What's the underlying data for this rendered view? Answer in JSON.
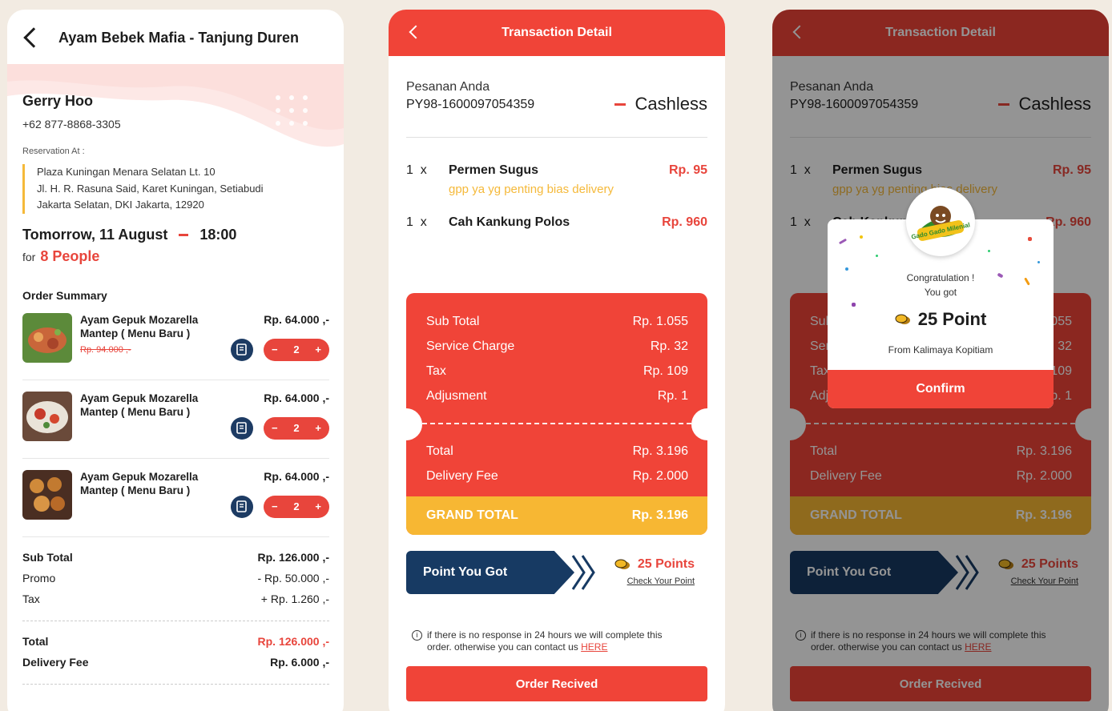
{
  "colors": {
    "accent_red": "#f04438",
    "navy": "#173a63",
    "gold": "#f7b733",
    "background": "#f2ebe2"
  },
  "reservation": {
    "header": {
      "title": "Ayam Bebek Mafia - Tanjung Duren",
      "back_icon": "chevron-left-icon"
    },
    "customer": {
      "name": "Gerry Hoo",
      "phone": "+62 877-8868-3305"
    },
    "reservation_label": "Reservation At :",
    "address": [
      "Plaza Kuningan Menara Selatan Lt. 10",
      "Jl. H. R. Rasuna Said, Karet Kuningan, Setiabudi",
      "Jakarta Selatan, DKI Jakarta, 12920"
    ],
    "date": "Tomorrow, 11 August",
    "time": "18:00",
    "for_label": "for",
    "people": "8 People",
    "order_summary_title": "Order Summary",
    "items": [
      {
        "name": "Ayam  Gepuk Mozarella Mantep ( Menu Baru )",
        "price": "Rp. 64.000 ,-",
        "old_price": "Rp. 94.000 ,-",
        "qty": "2"
      },
      {
        "name": "Ayam  Gepuk Mozarella Mantep ( Menu Baru )",
        "price": "Rp. 64.000 ,-",
        "old_price": "",
        "qty": "2"
      },
      {
        "name": "Ayam  Gepuk Mozarella Mantep ( Menu Baru )",
        "price": "Rp. 64.000 ,-",
        "old_price": "",
        "qty": "2"
      }
    ],
    "stepper": {
      "minus": "−",
      "plus": "+"
    },
    "summary": {
      "sub_total_label": "Sub Total",
      "sub_total": "Rp. 126.000 ,-",
      "promo_label": "Promo",
      "promo": "- Rp. 50.000 ,-",
      "tax_label": "Tax",
      "tax": "+ Rp. 1.260 ,-",
      "total_label": "Total",
      "total": "Rp. 126.000 ,-",
      "delivery_label": "Delivery Fee",
      "delivery": "Rp. 6.000 ,-"
    }
  },
  "transaction": {
    "header_title": "Transaction Detail",
    "order_label": "Pesanan Anda",
    "order_code": "PY98-1600097054359",
    "payment": "Cashless",
    "items": [
      {
        "qty": "1",
        "x": "x",
        "name": "Permen Sugus",
        "price": "Rp. 95",
        "note": "gpp ya yg penting bias delivery"
      },
      {
        "qty": "1",
        "x": "x",
        "name": "Cah Kankung Polos",
        "price": "Rp. 960",
        "note": ""
      }
    ],
    "costs": [
      {
        "label": "Sub Total",
        "value": "Rp. 1.055"
      },
      {
        "label": "Service Charge",
        "value": "Rp. 32"
      },
      {
        "label": "Tax",
        "value": "Rp. 109"
      },
      {
        "label": "Adjusment",
        "value": "Rp. 1"
      }
    ],
    "total_label": "Total",
    "total": "Rp. 3.196",
    "delivery_label": "Delivery Fee",
    "delivery": "Rp. 2.000",
    "grand_total_label": "GRAND TOTAL",
    "grand_total": "Rp. 3.196",
    "point_banner": "Point You Got",
    "points": "25 Points",
    "check_points": "Check Your Point",
    "info_text": "if there is no response in 24 hours we will complete this order. otherwise you can contact us",
    "info_link": "HERE",
    "button": "Order Recived"
  },
  "popup": {
    "logo_text": "Gado Gado Milenial",
    "congrats": "Congratulation !",
    "you_got": "You got",
    "points": "25 Point",
    "from": "From Kalimaya Kopitiam",
    "confirm": "Confirm"
  }
}
